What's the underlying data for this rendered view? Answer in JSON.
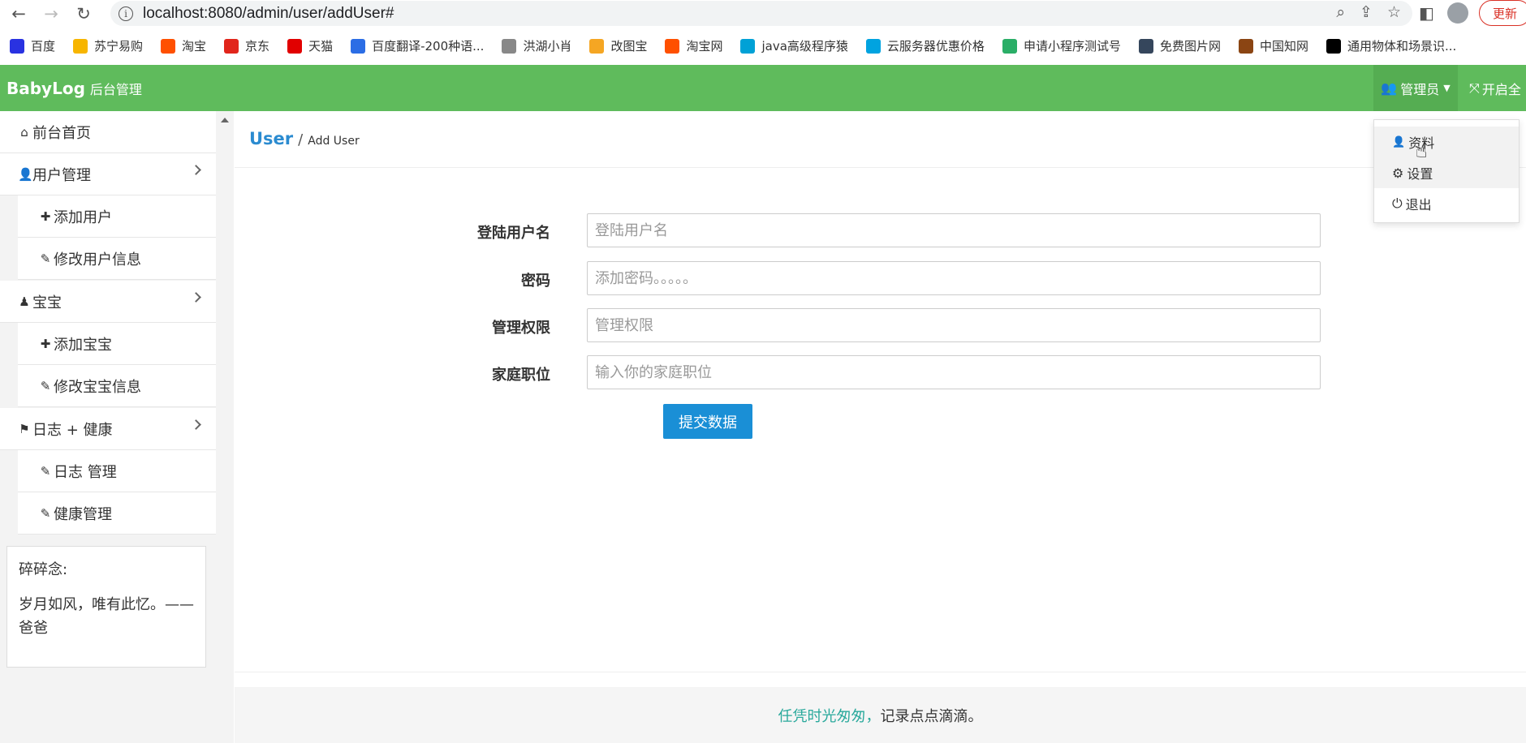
{
  "browser": {
    "url": "localhost:8080/admin/user/addUser#",
    "update_label": "更新"
  },
  "bookmarks": [
    {
      "label": "百度",
      "color": "#2932e1"
    },
    {
      "label": "苏宁易购",
      "color": "#f7b500"
    },
    {
      "label": "淘宝",
      "color": "#ff5000"
    },
    {
      "label": "京东",
      "color": "#e1251b"
    },
    {
      "label": "天猫",
      "color": "#e10000"
    },
    {
      "label": "百度翻译-200种语...",
      "color": "#2b6de5"
    },
    {
      "label": "洪湖小肖",
      "color": "#888888"
    },
    {
      "label": "改图宝",
      "color": "#f5a623"
    },
    {
      "label": "淘宝网",
      "color": "#ff5000"
    },
    {
      "label": "java高级程序猿",
      "color": "#00a1d6"
    },
    {
      "label": "云服务器优惠价格",
      "color": "#00a3e0"
    },
    {
      "label": "申请小程序测试号",
      "color": "#2aae67"
    },
    {
      "label": "免费图片网",
      "color": "#35465c"
    },
    {
      "label": "中国知网",
      "color": "#8b4513"
    },
    {
      "label": "通用物体和场景识...",
      "color": "#000000"
    }
  ],
  "header": {
    "brand": "BabyLog",
    "brand_sub": "后台管理",
    "admin_label": "管理员",
    "fullscreen_label": "开启全"
  },
  "sidebar": {
    "home": "前台首页",
    "user_mgmt": "用户管理",
    "add_user": "添加用户",
    "edit_user": "修改用户信息",
    "baby": "宝宝",
    "add_baby": "添加宝宝",
    "edit_baby": "修改宝宝信息",
    "log_health": "日志 + 健康",
    "log_mgmt": "日志 管理",
    "health_mgmt": "健康管理",
    "note_title": "碎碎念:",
    "note_body": "岁月如风，唯有此忆。——爸爸"
  },
  "breadcrumb": {
    "section": "User",
    "separator": "/",
    "current": "Add User"
  },
  "form": {
    "username_label": "登陆用户名",
    "username_placeholder": "登陆用户名",
    "password_label": "密码",
    "password_placeholder": "添加密码。。。。。",
    "permission_label": "管理权限",
    "permission_placeholder": "管理权限",
    "role_label": "家庭职位",
    "role_placeholder": "输入你的家庭职位",
    "submit_label": "提交数据"
  },
  "footer": {
    "part_a": "任凭时光匆匆，",
    "part_b": "记录点点滴滴。"
  },
  "dropdown": {
    "profile": "资料",
    "settings": "设置",
    "logout": "退出"
  }
}
